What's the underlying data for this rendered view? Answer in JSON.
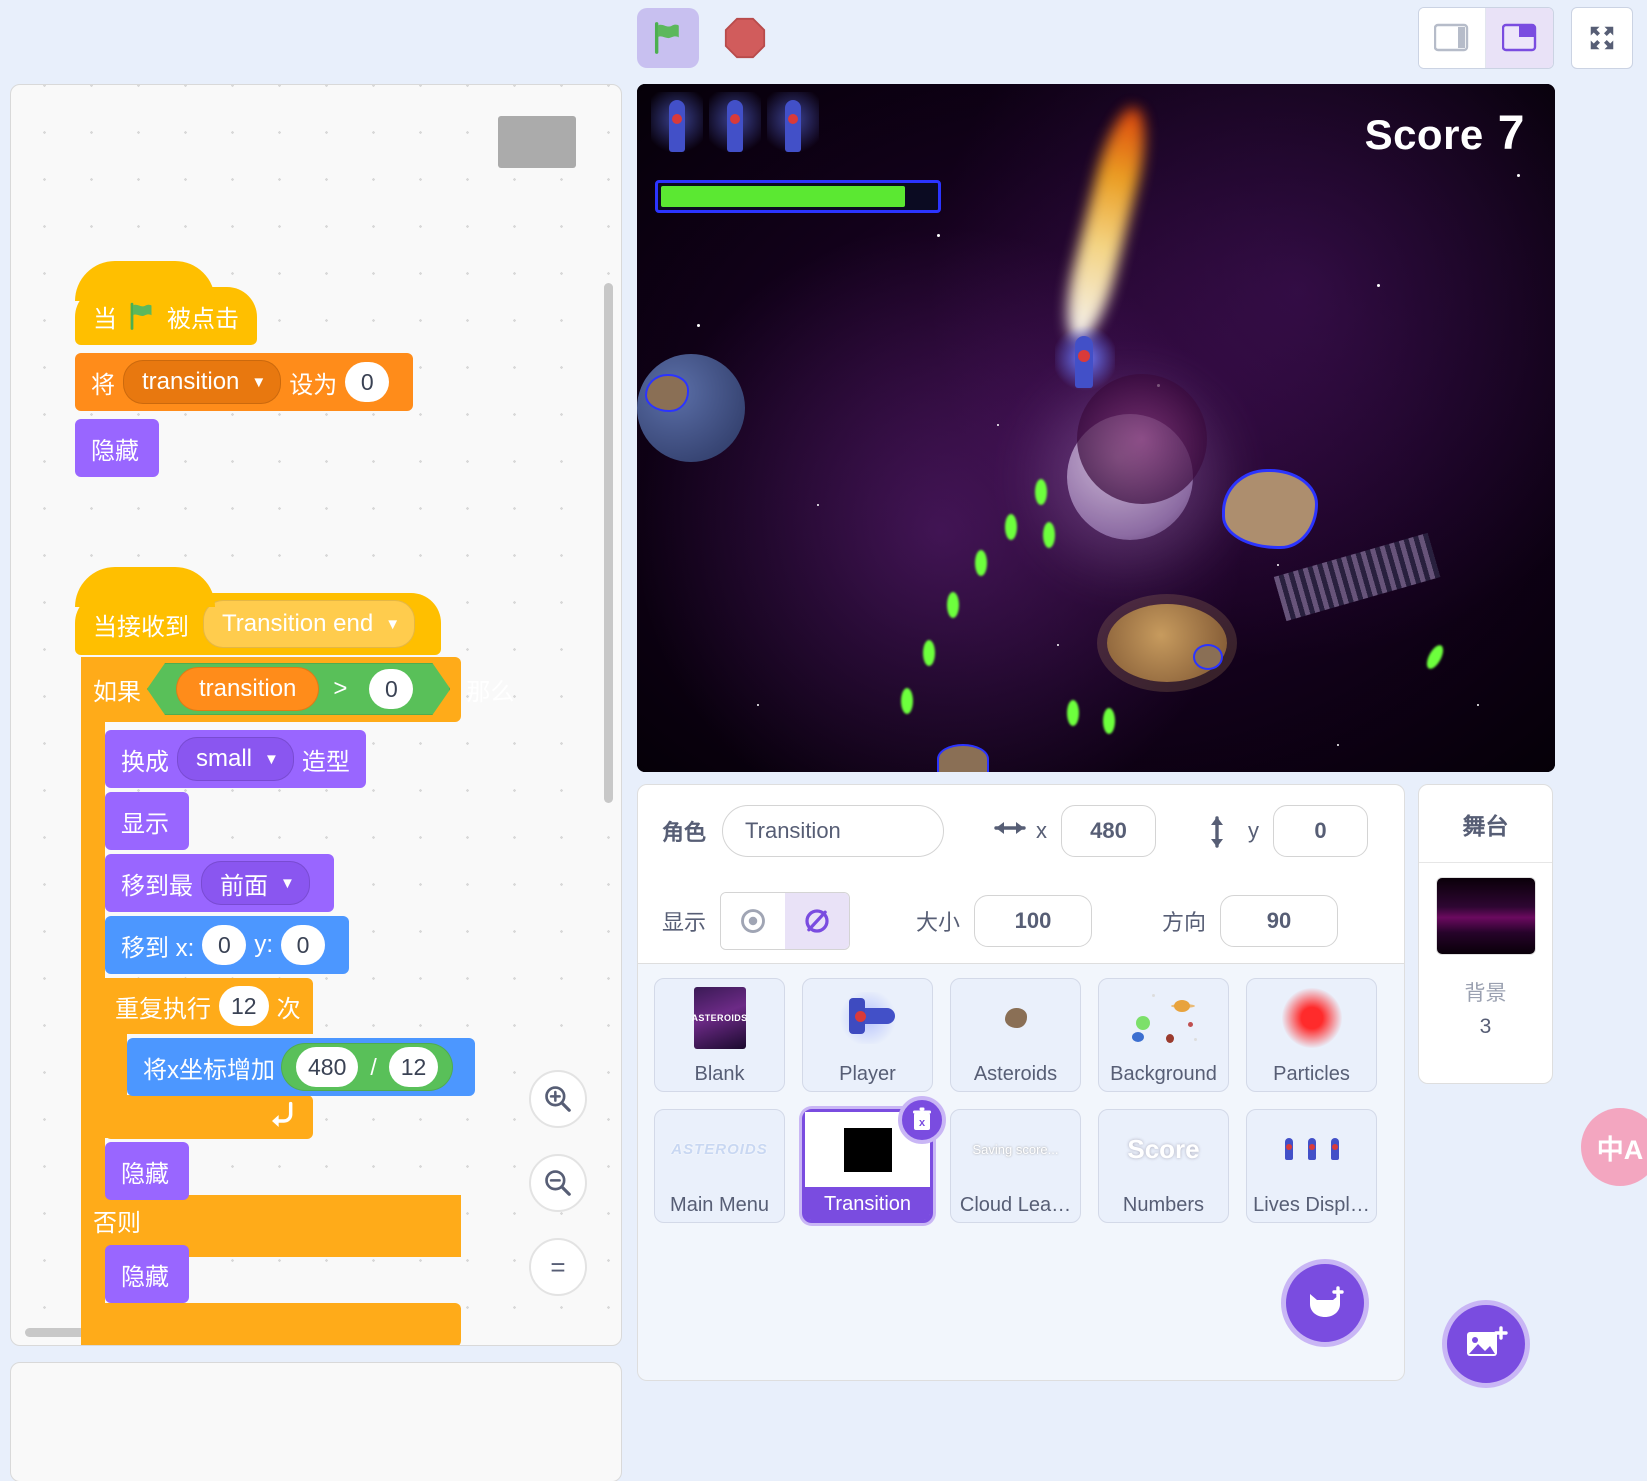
{
  "toolbar": {
    "green_flag_label": "green-flag",
    "stop_label": "stop",
    "layout_small_label": "small-stage-layout",
    "layout_large_label": "large-stage-layout",
    "fullscreen_label": "fullscreen"
  },
  "stage": {
    "score_label": "Score",
    "score_value": "7",
    "health_percent": 89
  },
  "code": {
    "script1": {
      "hat_when": "当",
      "hat_clicked": "被点击",
      "set_prefix": "将",
      "set_variable": "transition",
      "set_mid": "设为",
      "set_value": "0",
      "hide": "隐藏"
    },
    "script2": {
      "when_receive": "当接收到",
      "message": "Transition end",
      "if_label": "如果",
      "cond_var": "transition",
      "cond_op": ">",
      "cond_value": "0",
      "then_label": "那么",
      "switch_prefix": "换成",
      "costume": "small",
      "switch_suffix": "造型",
      "show": "显示",
      "goto_layer_prefix": "移到最",
      "layer": "前面",
      "goto_xy_prefix": "移到 x:",
      "goto_x": "0",
      "goto_y_label": "y:",
      "goto_y": "0",
      "repeat_prefix": "重复执行",
      "repeat_count": "12",
      "repeat_suffix": "次",
      "change_x_prefix": "将x坐标增加",
      "change_x_num": "480",
      "change_x_div": "/",
      "change_x_den": "12",
      "hide1": "隐藏",
      "else_label": "否则",
      "hide2": "隐藏"
    },
    "zoom_in": "zoom-in",
    "zoom_out": "zoom-out",
    "zoom_reset": "="
  },
  "sprite_info": {
    "sprite_label": "角色",
    "sprite_name": "Transition",
    "x_label": "x",
    "x_value": "480",
    "y_label": "y",
    "y_value": "0",
    "show_label": "显示",
    "size_label": "大小",
    "size_value": "100",
    "direction_label": "方向",
    "direction_value": "90",
    "visible": false
  },
  "sprites": [
    {
      "name": "Blank",
      "thumb": "asteroids-cover",
      "selected": false
    },
    {
      "name": "Player",
      "thumb": "player-ship",
      "selected": false
    },
    {
      "name": "Asteroids",
      "thumb": "asteroid-rock",
      "selected": false
    },
    {
      "name": "Background",
      "thumb": "planets-field",
      "selected": false
    },
    {
      "name": "Particles",
      "thumb": "red-glow",
      "selected": false
    },
    {
      "name": "Main Menu",
      "thumb": "asteroids-text",
      "selected": false
    },
    {
      "name": "Transition",
      "thumb": "black-square",
      "selected": true
    },
    {
      "name": "Cloud Lea…",
      "thumb": "saving-score",
      "selected": false,
      "thumb_text": "Saving score..."
    },
    {
      "name": "Numbers",
      "thumb": "score-text",
      "selected": false,
      "thumb_text": "Score"
    },
    {
      "name": "Lives Displ…",
      "thumb": "lives-ships",
      "selected": false
    }
  ],
  "sprite_actions": {
    "delete_badge": "delete-sprite",
    "add_sprite": "add-sprite",
    "add_backdrop": "add-backdrop"
  },
  "stage_pane": {
    "title": "舞台",
    "backdrops_label": "背景",
    "backdrops_count": "3"
  },
  "translate_widget": {
    "label": "中A"
  },
  "colors": {
    "accent_purple": "#7A4CE0",
    "motion_blue": "#4C97FF",
    "looks_purple": "#9966FF",
    "variables_orange": "#FF8C1A",
    "control_orange": "#FFAB19",
    "events_yellow": "#FFBF00",
    "operators_green": "#59C059",
    "app_bg": "#E8EFFB"
  }
}
